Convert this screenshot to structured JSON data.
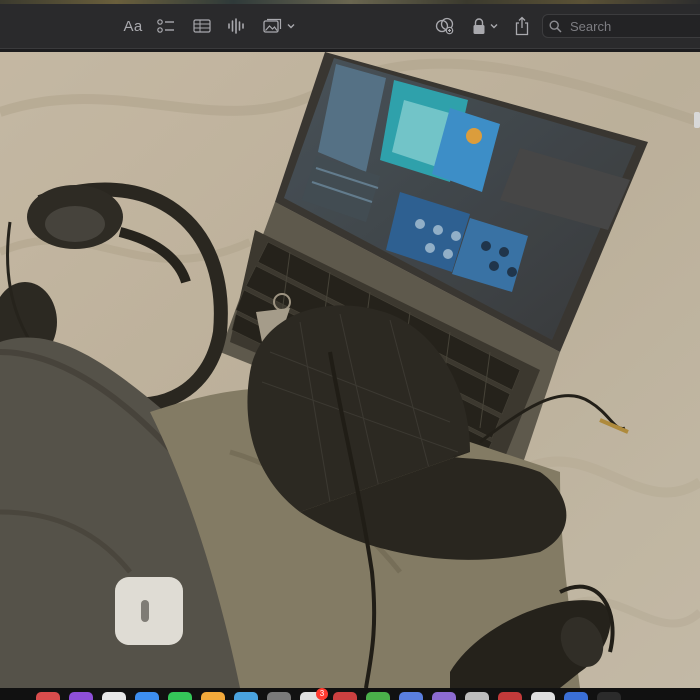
{
  "toolbar": {
    "format_label": "Aa",
    "format_icon": "text-format-icon",
    "checklist_icon": "checklist-icon",
    "table_icon": "table-icon",
    "audio_icon": "waveform-icon",
    "media_icon": "photo-icon",
    "collaborate_icon": "collaborate-icon",
    "lock_icon": "lock-icon",
    "share_icon": "share-icon",
    "search": {
      "placeholder": "Search",
      "value": ""
    }
  },
  "photo": {
    "subject_icon": "photo-content-icon"
  },
  "dock": {
    "badge_count": "3",
    "app_icons": [
      "#d94c4c",
      "#8e4fd8",
      "#e8e8e8",
      "#3d8ef0",
      "#34c759",
      "#f2a93b",
      "#4aa3df",
      "#7a7a7a",
      "#e0e0e0",
      "#cc4040",
      "#4ab04a",
      "#5a7fe0",
      "#8c6bd1",
      "#bdbdbd",
      "#c23a3a",
      "#dfdfdf",
      "#3a6fd6",
      "#2b2b2b"
    ]
  },
  "colors": {
    "toolbar_bg": "#2a2a2c",
    "icon_color": "#a9a9ae",
    "accent": "#0a84ff"
  }
}
